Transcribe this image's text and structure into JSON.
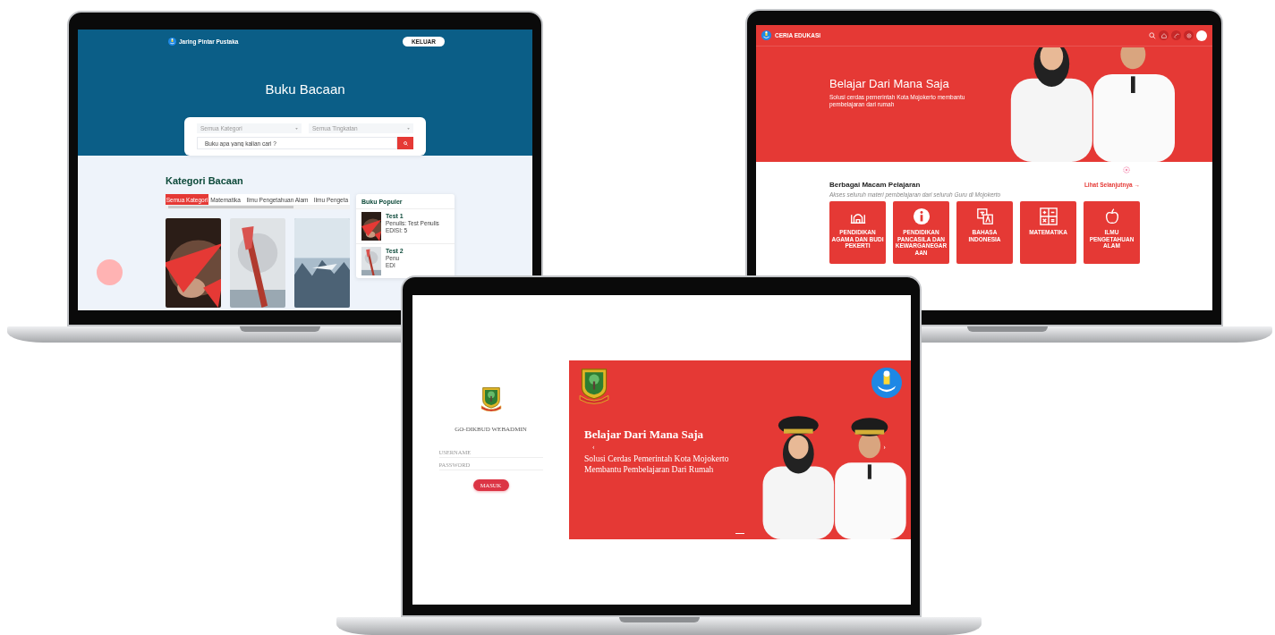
{
  "library_site": {
    "brand": "Jaring Pintar Pustaka",
    "logout_button": "KELUAR",
    "title": "Buku Bacaan",
    "category_select": "Semua Kategori",
    "level_select": "Semua Tingkatan",
    "search": {
      "placeholder": "Buku apa yang kalian cari ?"
    },
    "section_title": "Kategori Bacaan",
    "tabs": [
      {
        "label": "Semua Kategori",
        "selected": true
      },
      {
        "label": "Matematika",
        "selected": false
      },
      {
        "label": "Ilmu Pengetahuan Alam",
        "selected": false
      },
      {
        "label": "Ilmu Pengeta",
        "selected": false
      }
    ],
    "popular": {
      "title": "Buku Populer",
      "items": [
        {
          "title": "Test 1",
          "author": "Penulis: Test Penulis",
          "edition": "EDISI: 5"
        },
        {
          "title": "Test 2",
          "author": "Penu",
          "edition": "EDI"
        }
      ]
    }
  },
  "education_portal": {
    "brand": "CERIA EDUKASI",
    "hero": {
      "title": "Belajar Dari Mana Saja",
      "subtitle": "Solusi cerdas pemerintah Kota Mojokerto membantu pembelajaran dari rumah"
    },
    "section": {
      "title": "Berbagai Macam Pelajaran",
      "link": "Lihat Selanjutnya →",
      "subtitle": "Akses seluruh materi pembelajaran dari seluruh Guru di Mojokerto"
    },
    "subjects": [
      {
        "name": "PENDIDIKAN AGAMA DAN BUDI PEKERTI",
        "kind": "mosque"
      },
      {
        "name": "PENDIDIKAN PANCASILA DAN KEWARGANEGARAAN",
        "kind": "info"
      },
      {
        "name": "BAHASA INDONESIA",
        "kind": "translate"
      },
      {
        "name": "MATEMATIKA",
        "kind": "math"
      },
      {
        "name": "ILMU PENGETAHUAN ALAM",
        "kind": "apple"
      }
    ]
  },
  "admin_login": {
    "title": "GO-DIKBUD WEBADMIN",
    "username": {
      "placeholder": "USERNAME"
    },
    "password": {
      "placeholder": "PASSWORD"
    },
    "submit": "MASUK",
    "slide": {
      "title": "Belajar Dari Mana Saja",
      "subtitle": "Solusi Cerdas Pemerintah Kota Mojokerto Membantu Pembelajaran Dari Rumah",
      "prev": "‹",
      "next": "›"
    }
  }
}
